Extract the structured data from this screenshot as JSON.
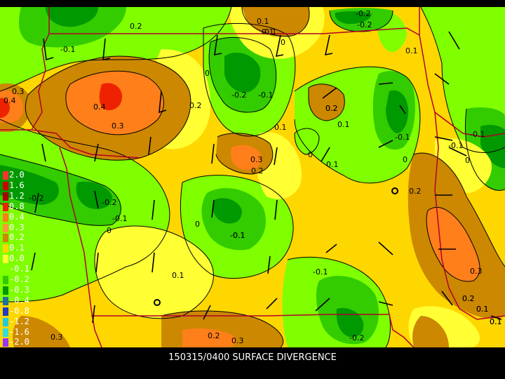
{
  "caption": "150315/0400 SURFACE DIVERGENCE",
  "colors": {
    "bg": "#000000",
    "contour": "#000000",
    "boundary": "#b2002b",
    "fill_green_light": "#7fff00",
    "fill_green_mid": "#33cc00",
    "fill_green_dark": "#009900",
    "fill_yellow": "#ffff33",
    "fill_gold": "#ffd700",
    "fill_brown": "#cc8800",
    "fill_orange": "#ff7f1a",
    "fill_red": "#ee2200"
  },
  "legend": [
    {
      "label": "2.0",
      "color": "#ff3333"
    },
    {
      "label": "1.6",
      "color": "#cc0000"
    },
    {
      "label": "1.2",
      "color": "#aa0000"
    },
    {
      "label": "0.8",
      "color": "#ee2200"
    },
    {
      "label": "0.4",
      "color": "#ff7f1a"
    },
    {
      "label": "0.3",
      "color": "#ff9933"
    },
    {
      "label": "0.2",
      "color": "#cc8800"
    },
    {
      "label": "0.1",
      "color": "#ffd700"
    },
    {
      "label": "0.0",
      "color": "#ffff33"
    },
    {
      "label": "-0.1",
      "color": "#7fff00"
    },
    {
      "label": "-0.2",
      "color": "#33cc00"
    },
    {
      "label": "-0.3",
      "color": "#009900"
    },
    {
      "label": "-0.4",
      "color": "#1f6f9f"
    },
    {
      "label": "-0.8",
      "color": "#1f3fbf"
    },
    {
      "label": "-1.2",
      "color": "#22ccdd"
    },
    {
      "label": "-1.6",
      "color": "#33dddd"
    },
    {
      "label": "-2.0",
      "color": "#9933ff"
    }
  ],
  "contour_labels": [
    "-0.2",
    "0.2",
    "0.1",
    "-0.2",
    "-0.1",
    "0",
    "-0.1",
    "0.1",
    "0.1",
    "0.3",
    "0.4",
    "0.4",
    "0.3",
    "0.2",
    "-0.2",
    "-0.1",
    "0.2",
    "0",
    "0.2",
    "0.1",
    "-0.1",
    "-0.1",
    "0.1",
    "0",
    "0.3",
    "0.2",
    "0.1",
    "0",
    "0",
    "-0.1",
    "0.2",
    "-0.2",
    "-0.2",
    "-0.1",
    "0",
    "0",
    "-0.1",
    "0.1",
    "-0.1",
    "-0.1",
    "-0.2",
    "0.3",
    "0.2",
    "0.1",
    "0.3",
    "0.2",
    "0.3",
    "0.2",
    "0.1",
    "0.1",
    "0.1"
  ]
}
